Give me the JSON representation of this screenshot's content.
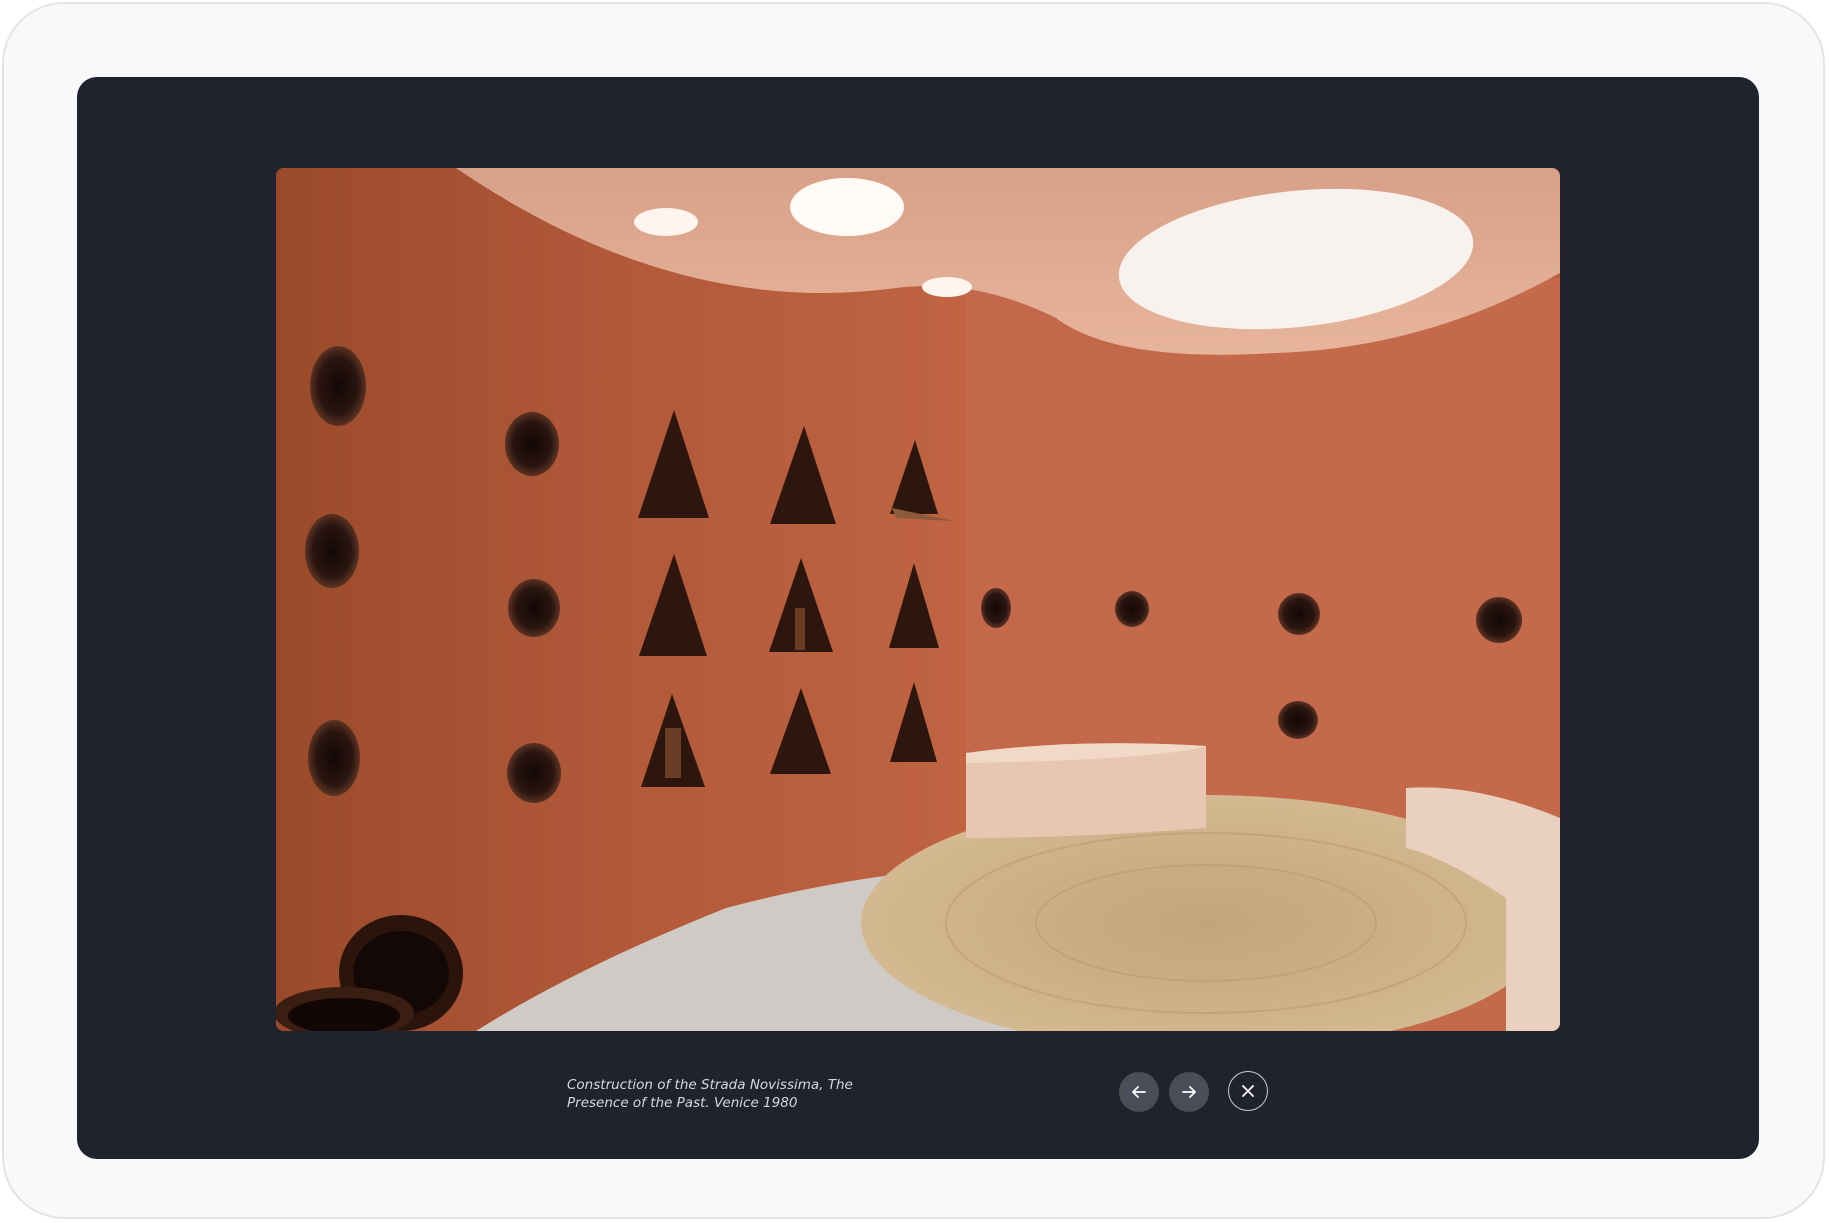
{
  "lightbox": {
    "caption_line1": "Construction of the Strada Novissima, The",
    "caption_line2": "Presence of the Past. Venice 1980",
    "prev_icon": "arrow-left-icon",
    "next_icon": "arrow-right-icon",
    "close_icon": "close-icon"
  },
  "colors": {
    "backdrop": "#20232d",
    "frame": "#f8f9fa",
    "nav_button": "#4a4e59",
    "icon": "#ffffff"
  }
}
